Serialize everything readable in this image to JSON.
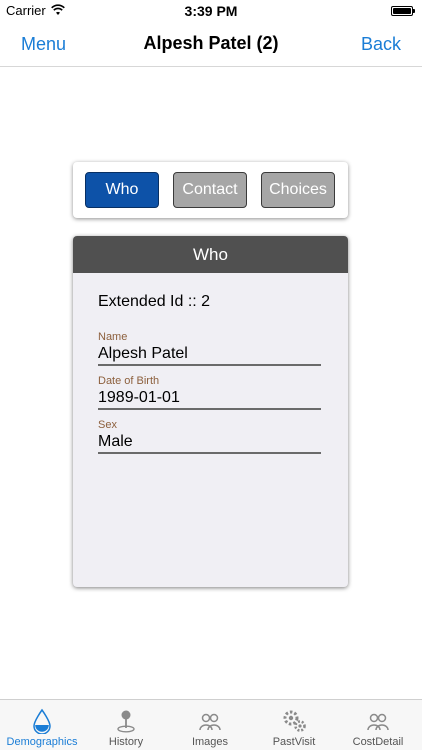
{
  "status_bar": {
    "carrier": "Carrier",
    "time": "3:39 PM"
  },
  "nav": {
    "left": "Menu",
    "title": "Alpesh Patel (2)",
    "right": "Back"
  },
  "segments": [
    {
      "label": "Who",
      "active": true
    },
    {
      "label": "Contact",
      "active": false
    },
    {
      "label": "Choices",
      "active": false
    }
  ],
  "card": {
    "header": "Who",
    "extended_id": "Extended Id :: 2",
    "fields": [
      {
        "label": "Name",
        "value": "Alpesh  Patel"
      },
      {
        "label": "Date of Birth",
        "value": "1989-01-01"
      },
      {
        "label": "Sex",
        "value": "Male"
      }
    ]
  },
  "tabs": [
    {
      "label": "Demographics",
      "icon": "drop-icon",
      "active": true
    },
    {
      "label": "History",
      "icon": "pin-icon",
      "active": false
    },
    {
      "label": "Images",
      "icon": "people-icon",
      "active": false
    },
    {
      "label": "PastVisit",
      "icon": "gears-icon",
      "active": false
    },
    {
      "label": "CostDetail",
      "icon": "people-icon",
      "active": false
    }
  ],
  "colors": {
    "accent": "#1a7dd6",
    "active_segment": "#0d52a8",
    "inactive_segment": "#a6a6a6",
    "card_header": "#505050",
    "label_brown": "#8c5f3c"
  }
}
